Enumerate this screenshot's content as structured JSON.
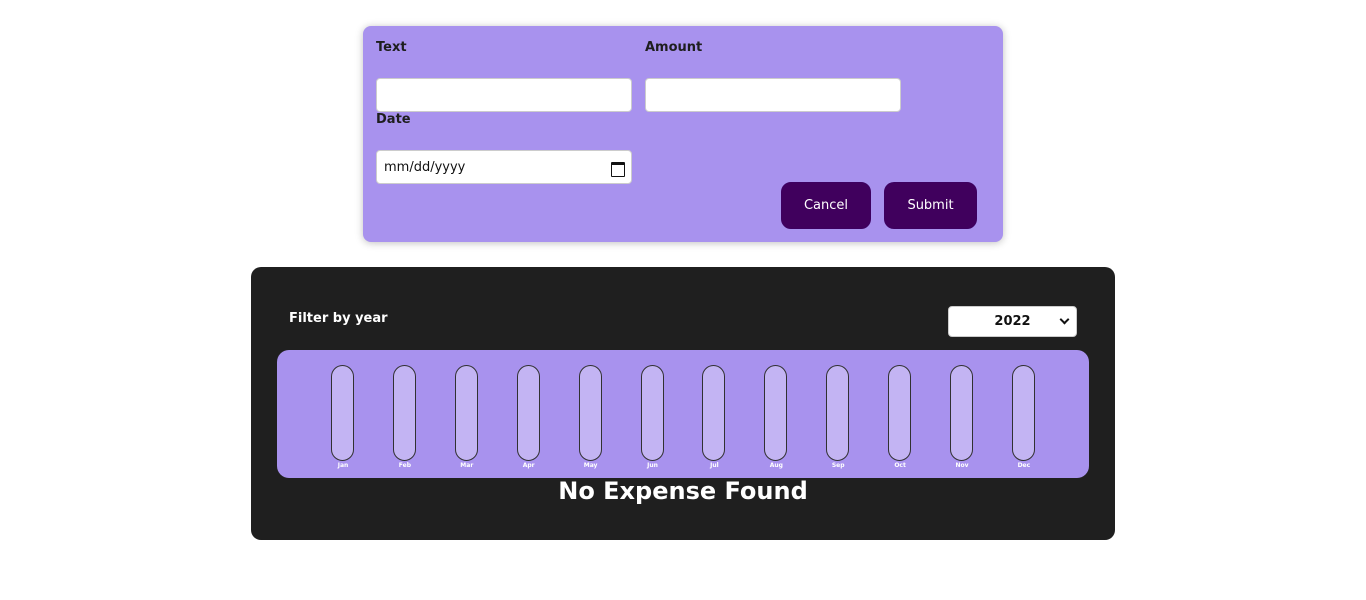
{
  "form": {
    "text_label": "Text",
    "text_value": "",
    "amount_label": "Amount",
    "amount_value": "",
    "date_label": "Date",
    "date_placeholder": "mm/dd/yyyy",
    "date_icon": "calendar-icon",
    "cancel_label": "Cancel",
    "submit_label": "Submit"
  },
  "expenses": {
    "filter_label": "Filter by year",
    "selected_year": "2022",
    "empty_message": "No Expense Found"
  },
  "chart_data": {
    "type": "bar",
    "categories": [
      "Jan",
      "Feb",
      "Mar",
      "Apr",
      "May",
      "Jun",
      "Jul",
      "Aug",
      "Sep",
      "Oct",
      "Nov",
      "Dec"
    ],
    "values": [
      0,
      0,
      0,
      0,
      0,
      0,
      0,
      0,
      0,
      0,
      0,
      0
    ]
  },
  "colors": {
    "form_bg": "#a892ee",
    "button_bg": "#40005d",
    "panel_bg": "#1f1f1f",
    "bar_track": "#c3b4f3"
  }
}
